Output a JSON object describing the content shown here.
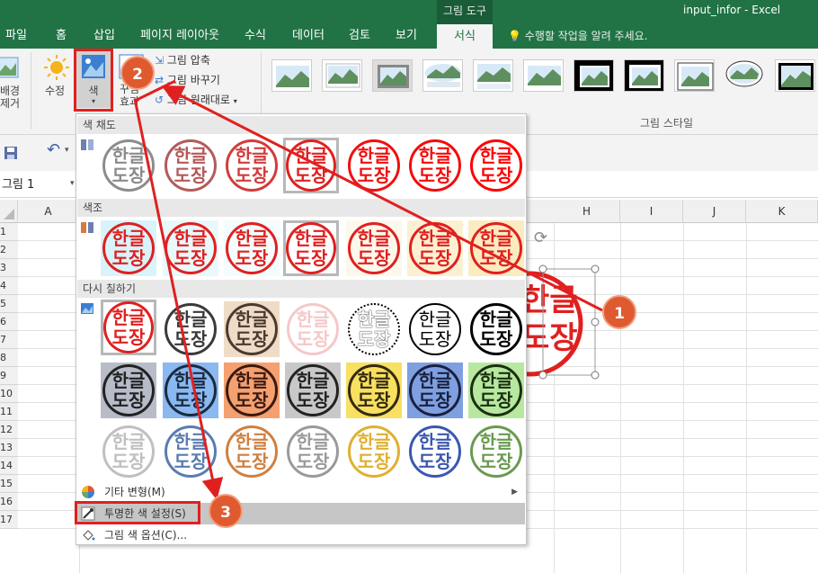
{
  "title_bar": {
    "context_group": "그림 도구",
    "window_title": "input_infor - Excel"
  },
  "tabs": [
    {
      "label": "파일"
    },
    {
      "label": "홈"
    },
    {
      "label": "삽입"
    },
    {
      "label": "페이지 레이아웃"
    },
    {
      "label": "수식"
    },
    {
      "label": "데이터"
    },
    {
      "label": "검토"
    },
    {
      "label": "보기"
    },
    {
      "label": "서식"
    }
  ],
  "tell_me": "수행할 작업을 알려 주세요.",
  "ribbon": {
    "remove_bg": "배경\n제거",
    "corrections": "수정",
    "color": "색",
    "artistic": "꾸밈\n효과",
    "compress": "그림 압축",
    "change": "그림 바꾸기",
    "reset": "그림 원래대로",
    "styles_group": "그림 스타일"
  },
  "name_box": "그림 1",
  "columns": [
    "A",
    "H",
    "I",
    "J",
    "K"
  ],
  "rows": [
    "1",
    "2",
    "3",
    "4",
    "5",
    "6",
    "7",
    "8",
    "9",
    "10",
    "11",
    "12",
    "13",
    "14",
    "15",
    "16",
    "17"
  ],
  "stamp_text": {
    "line1": "한글",
    "line2": "도장"
  },
  "dropdown": {
    "saturation": "색 채도",
    "tone": "색조",
    "recolor": "다시 칠하기",
    "more_variations": "기타 변형(M)",
    "set_transparent": "투명한 색 설정(S)",
    "picture_color_options": "그림 색 옵션(C)..."
  },
  "badges": [
    "1",
    "2",
    "3"
  ],
  "colors": {
    "excel_green": "#217346",
    "stamp_red": "#e02020",
    "annotation": "#e05a30"
  },
  "icons": [
    "save-icon",
    "undo-icon",
    "rotate-icon",
    "bulb-icon"
  ]
}
